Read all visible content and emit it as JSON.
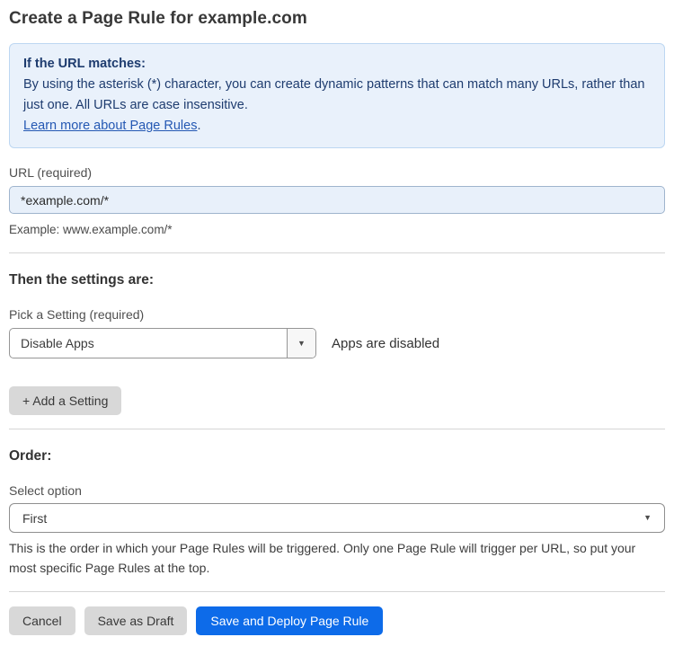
{
  "page": {
    "title": "Create a Page Rule for example.com"
  },
  "info_box": {
    "heading": "If the URL matches:",
    "body": "By using the asterisk (*) character, you can create dynamic patterns that can match many URLs, rather than just one. All URLs are case insensitive.",
    "link_label": "Learn more about Page Rules",
    "link_suffix": "."
  },
  "url_field": {
    "label": "URL (required)",
    "value": "*example.com/*",
    "helper": "Example: www.example.com/*"
  },
  "settings_section": {
    "heading": "Then the settings are:",
    "setting_label": "Pick a Setting (required)",
    "setting_value": "Disable Apps",
    "setting_status": "Apps are disabled",
    "add_button_label": "+ Add a Setting"
  },
  "order_section": {
    "heading": "Order:",
    "select_label": "Select option",
    "select_value": "First",
    "helper": "This is the order in which your Page Rules will be triggered. Only one Page Rule will trigger per URL, so put your most specific Page Rules at the top."
  },
  "footer": {
    "cancel_label": "Cancel",
    "save_draft_label": "Save as Draft",
    "save_deploy_label": "Save and Deploy Page Rule"
  },
  "icons": {
    "dropdown_arrow": "▼"
  },
  "colors": {
    "info_bg": "#e9f1fb",
    "info_border": "#bdd7f2",
    "info_text": "#1e3c6f",
    "link": "#2458b3",
    "input_bg": "#e8f0fa",
    "primary_button": "#0d6be9",
    "secondary_button": "#d8d8d8"
  }
}
